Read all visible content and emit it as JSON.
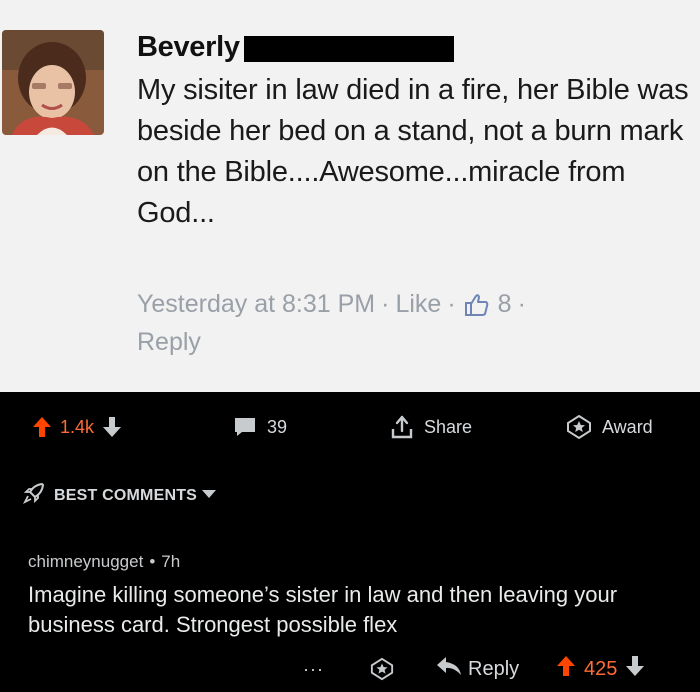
{
  "facebook": {
    "name": "Beverly",
    "text": "My sisiter in law died in a fire, her Bible was beside her bed on a stand, not a burn mark on the Bible....Awesome...miracle from God...",
    "timestamp": "Yesterday at 8:31 PM",
    "like_label": "Like",
    "like_count": "8",
    "reply_label": "Reply",
    "dot": "·"
  },
  "reddit": {
    "post_bar": {
      "upvotes": "1.4k",
      "comments": "39",
      "share_label": "Share",
      "award_label": "Award"
    },
    "sort_label": "BEST COMMENTS",
    "comment": {
      "username": "chimneynugget",
      "bullet": "•",
      "age": "7h",
      "body": "Imagine killing someone’s sister in law and then leaving your business card. Strongest possible flex",
      "more": "···",
      "reply_label": "Reply",
      "score": "425"
    },
    "colors": {
      "upvote": "#ff6c37",
      "text": "#d7dadc",
      "background": "#000000"
    }
  }
}
